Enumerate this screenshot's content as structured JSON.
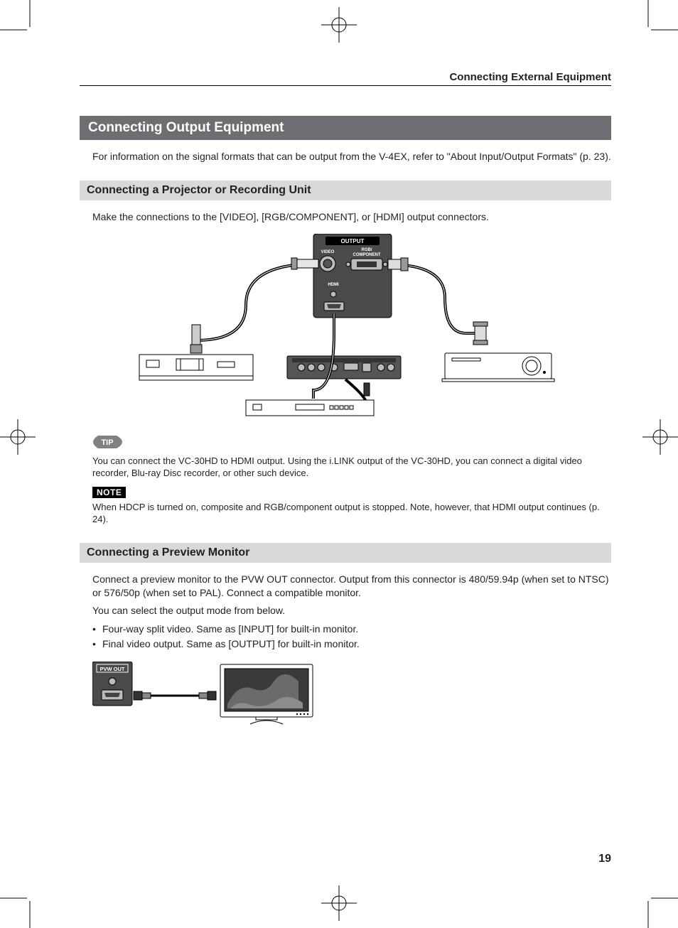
{
  "running_head": "Connecting External Equipment",
  "h1": "Connecting Output Equipment",
  "intro": "For information on the signal formats that can be output from the V-4EX, refer to \"About Input/Output Formats\" (p. 23).",
  "section1": {
    "heading": "Connecting a Projector or Recording Unit",
    "para": "Make the connections to the [VIDEO], [RGB/COMPONENT], or [HDMI] output connectors.",
    "panel_labels": {
      "title": "OUTPUT",
      "video": "VIDEO",
      "rgb": "RGB/\nCOMPONENT",
      "hdmi": "HDMI"
    },
    "tip_label": "TIP",
    "tip_text": "You can connect the VC-30HD to HDMI output. Using the i.LINK output of the VC-30HD, you can connect a digital video recorder, Blu-ray Disc recorder, or other such device.",
    "note_label": "NOTE",
    "note_text": "When HDCP is turned on, composite and RGB/component output is stopped. Note, however, that HDMI output continues (p. 24)."
  },
  "section2": {
    "heading": "Connecting a Preview Monitor",
    "para1": "Connect a preview monitor to the PVW OUT connector. Output from this connector is 480/59.94p (when set to NTSC) or 576/50p (when set to PAL). Connect a compatible monitor.",
    "para2": "You can select the output mode from below.",
    "bullets": [
      "Four-way split video. Same as [INPUT] for built-in monitor.",
      "Final video output. Same as [OUTPUT] for built-in monitor."
    ],
    "panel_label": "PVW OUT"
  },
  "page_number": "19"
}
